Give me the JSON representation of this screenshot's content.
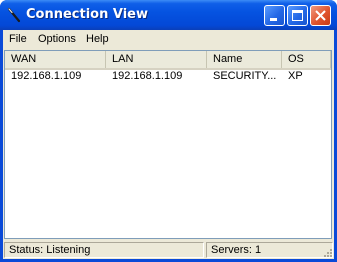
{
  "window": {
    "title": "Connection View",
    "icon": "pen-icon",
    "controls": [
      "minimize-icon",
      "maximize-icon",
      "close-icon"
    ]
  },
  "menu": {
    "items": [
      {
        "label": "File"
      },
      {
        "label": "Options"
      },
      {
        "label": "Help"
      }
    ]
  },
  "table": {
    "columns": [
      {
        "label": "WAN"
      },
      {
        "label": "LAN"
      },
      {
        "label": "Name"
      },
      {
        "label": "OS"
      }
    ],
    "rows": [
      [
        "192.168.1.109",
        "192.168.1.109",
        "SECURITY...",
        "XP"
      ]
    ]
  },
  "status": {
    "left": "Status: Listening",
    "right": "Servers: 1"
  },
  "colors": {
    "titlebar": "#0553e1",
    "client": "#ece9d8",
    "close_button": "#e0542e"
  }
}
